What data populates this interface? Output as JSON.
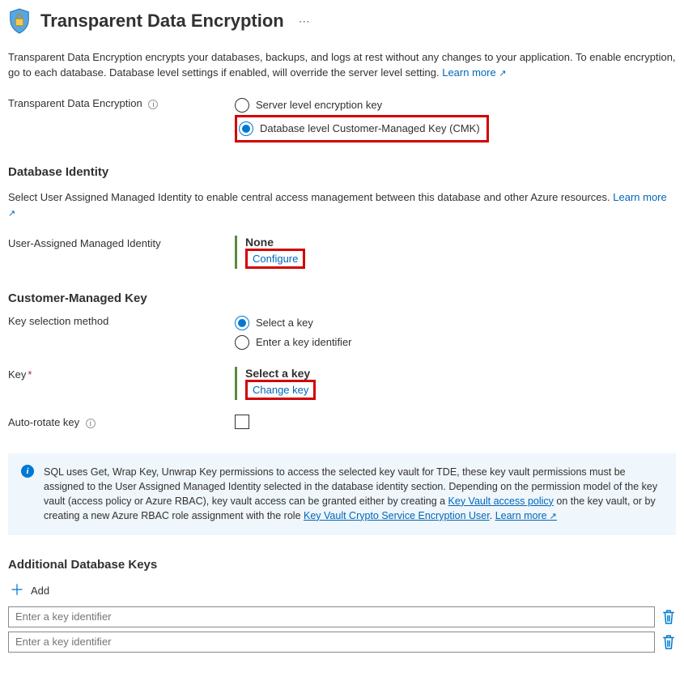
{
  "header": {
    "title": "Transparent Data Encryption"
  },
  "description": {
    "text": "Transparent Data Encryption encrypts your databases, backups, and logs at rest without any changes to your application. To enable encryption, go to each database. Database level settings if enabled, will override the server level setting.",
    "learn_more": "Learn more"
  },
  "tde": {
    "label": "Transparent Data Encryption",
    "options": {
      "server": "Server level encryption key",
      "cmk": "Database level Customer-Managed Key (CMK)"
    }
  },
  "identity": {
    "heading": "Database Identity",
    "desc": "Select User Assigned Managed Identity to enable central access management between this database and other Azure resources.",
    "learn_more": "Learn more",
    "uami_label": "User-Assigned Managed Identity",
    "uami_value": "None",
    "configure": "Configure"
  },
  "cmk": {
    "heading": "Customer-Managed Key",
    "ksm_label": "Key selection method",
    "options": {
      "select": "Select a key",
      "enter": "Enter a key identifier"
    },
    "key_label": "Key",
    "key_value": "Select a key",
    "change_key": "Change key",
    "autorotate_label": "Auto-rotate key"
  },
  "info": {
    "text1": "SQL uses Get, Wrap Key, Unwrap Key permissions to access the selected key vault for TDE, these key vault permissions must be assigned to the User Assigned Managed Identity selected in the database identity section. Depending on the permission model of the key vault (access policy or Azure RBAC), key vault access can be granted either by creating a ",
    "link1": "Key Vault access policy",
    "text2": " on the key vault, or by creating a new Azure RBAC role assignment with the role ",
    "link2": "Key Vault Crypto Service Encryption User",
    "learn_more": "Learn more"
  },
  "additional": {
    "heading": "Additional Database Keys",
    "add": "Add",
    "placeholder": "Enter a key identifier"
  }
}
